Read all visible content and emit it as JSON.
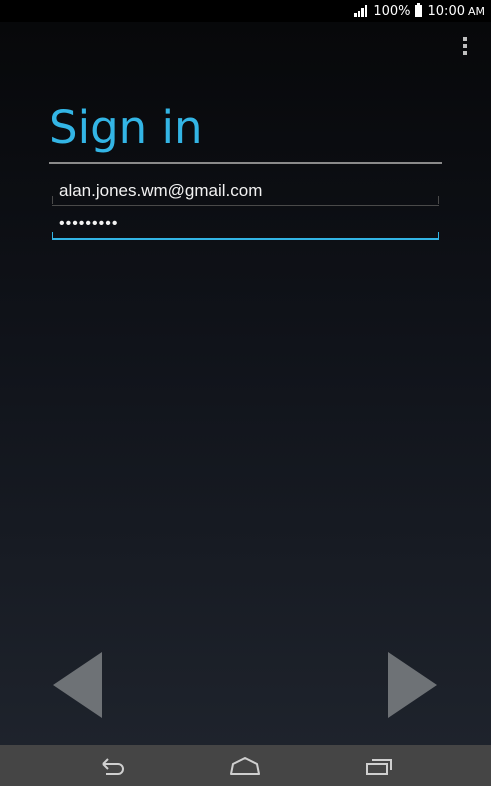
{
  "status_bar": {
    "battery_percent": "100%",
    "time": "10:00",
    "time_suffix": "AM",
    "icons": [
      "signal-icon",
      "battery-icon"
    ]
  },
  "action_bar": {
    "overflow_icon": "overflow-menu-icon"
  },
  "signin": {
    "title": "Sign in",
    "email_value": "alan.jones.wm@gmail.com",
    "password_value": "•••••••••",
    "accent_color": "#33b5e5"
  },
  "pager": {
    "prev_icon": "left-arrow-icon",
    "next_icon": "right-arrow-icon"
  },
  "nav_bar": {
    "icons": [
      "back-icon",
      "home-icon",
      "recent-apps-icon"
    ]
  }
}
